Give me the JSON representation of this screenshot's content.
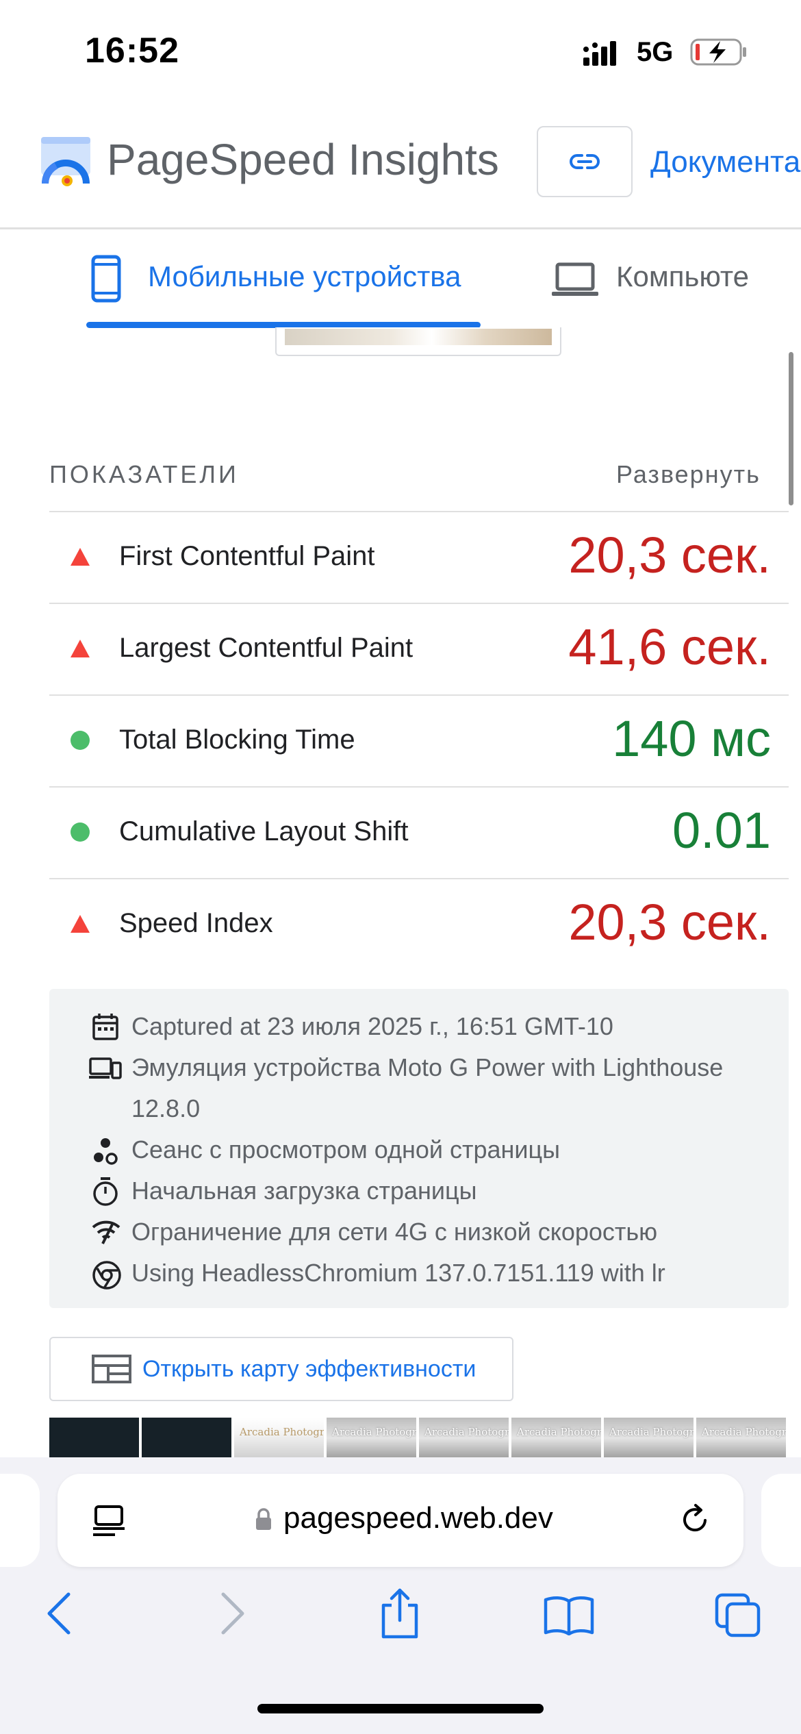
{
  "status_bar": {
    "time": "16:52",
    "network": "5G"
  },
  "header": {
    "title": "PageSpeed Insights",
    "docs_link": "Документа"
  },
  "tabs": [
    {
      "label": "Мобильные устройства",
      "active": true,
      "icon": "mobile-icon"
    },
    {
      "label": "Компьюте",
      "active": false,
      "icon": "laptop-icon"
    }
  ],
  "metrics": {
    "heading": "ПОКАЗАТЕЛИ",
    "expand": "Развернуть",
    "items": [
      {
        "label": "First Contentful Paint",
        "value": "20,3 сек.",
        "status": "bad"
      },
      {
        "label": "Largest Contentful Paint",
        "value": "41,6 сек.",
        "status": "bad"
      },
      {
        "label": "Total Blocking Time",
        "value": "140 мс",
        "status": "good"
      },
      {
        "label": "Cumulative Layout Shift",
        "value": "0.01",
        "status": "good"
      },
      {
        "label": "Speed Index",
        "value": "20,3 сек.",
        "status": "bad"
      }
    ]
  },
  "info": {
    "captured": "Captured at 23 июля 2025 г., 16:51 GMT-10",
    "emulation_line1": "Эмуляция устройства Moto G Power with Lighthouse",
    "emulation_line2": "12.8.0",
    "session": "Сеанс с просмотром одной страницы",
    "load": "Начальная загрузка страницы",
    "throttling": "Ограничение для сети 4G с низкой скоростью",
    "browser": "Using HeadlessChromium 137.0.7151.119 with lr"
  },
  "treemap_button": "Открыть карту эффективности",
  "filmstrip": {
    "frame_text": "Arcadia Photogr",
    "frame_text_short": "Arcadia Photogr"
  },
  "browser": {
    "url": "pagespeed.web.dev"
  },
  "colors": {
    "accent": "#1a73e8",
    "bad": "#c5221f",
    "good": "#188038",
    "bad_icon": "#f4433b",
    "good_icon": "#4cbd6a"
  }
}
